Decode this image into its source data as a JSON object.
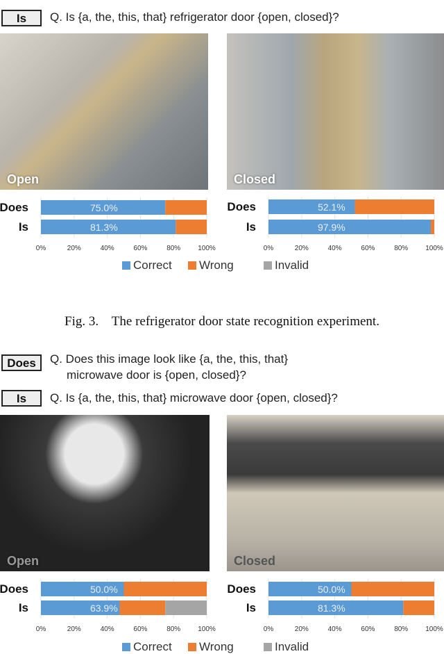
{
  "section1": {
    "is_tag": "Is",
    "is_question": "Q. Is {a, the, this, that} refrigerator door {open, closed}?",
    "images": [
      {
        "label": "Open"
      },
      {
        "label": "Closed"
      }
    ],
    "caption": "Fig. 3.    The refrigerator door state recognition experiment."
  },
  "section2": {
    "does_tag": "Does",
    "does_question_line1": "Q. Does this image look like {a, the, this, that}",
    "does_question_line2": "microwave door is {open, closed}?",
    "is_tag": "Is",
    "is_question": "Q. Is {a, the, this, that} microwave door {open, closed}?",
    "images": [
      {
        "label": "Open"
      },
      {
        "label": "Closed"
      }
    ]
  },
  "colors": {
    "Correct": "#5b9bd5",
    "Wrong": "#ed7d31",
    "Invalid": "#a5a5a5"
  },
  "chart_data": [
    {
      "type": "bar",
      "orientation": "horizontal-stacked",
      "categories": [
        "Does",
        "Is"
      ],
      "series": [
        {
          "name": "Correct",
          "values": [
            75.0,
            81.3
          ]
        },
        {
          "name": "Wrong",
          "values": [
            25.0,
            18.7
          ]
        },
        {
          "name": "Invalid",
          "values": [
            0,
            0
          ]
        }
      ],
      "data_labels": [
        "75.0%",
        "81.3%"
      ],
      "xticks": [
        "0%",
        "20%",
        "40%",
        "60%",
        "80%",
        "100%"
      ],
      "xlim": [
        0,
        100
      ],
      "legend": "bottom"
    },
    {
      "type": "bar",
      "orientation": "horizontal-stacked",
      "categories": [
        "Does",
        "Is"
      ],
      "series": [
        {
          "name": "Correct",
          "values": [
            52.1,
            97.9
          ]
        },
        {
          "name": "Wrong",
          "values": [
            47.9,
            2.1
          ]
        },
        {
          "name": "Invalid",
          "values": [
            0,
            0
          ]
        }
      ],
      "data_labels": [
        "52.1%",
        "97.9%"
      ],
      "xticks": [
        "0%",
        "20%",
        "40%",
        "60%",
        "80%",
        "100%"
      ],
      "xlim": [
        0,
        100
      ],
      "legend": "bottom"
    },
    {
      "type": "bar",
      "orientation": "horizontal-stacked",
      "categories": [
        "Does",
        "Is"
      ],
      "series": [
        {
          "name": "Correct",
          "values": [
            50.0,
            47.5
          ]
        },
        {
          "name": "Wrong",
          "values": [
            50.0,
            27.5
          ]
        },
        {
          "name": "Invalid",
          "values": [
            0,
            25.0
          ]
        }
      ],
      "data_labels": [
        "50.0%",
        "63.9%"
      ],
      "xticks": [
        "0%",
        "20%",
        "40%",
        "60%",
        "80%",
        "100%"
      ],
      "xlim": [
        0,
        100
      ],
      "legend": "bottom"
    },
    {
      "type": "bar",
      "orientation": "horizontal-stacked",
      "categories": [
        "Does",
        "Is"
      ],
      "series": [
        {
          "name": "Correct",
          "values": [
            50.0,
            81.3
          ]
        },
        {
          "name": "Wrong",
          "values": [
            50.0,
            18.7
          ]
        },
        {
          "name": "Invalid",
          "values": [
            0,
            0
          ]
        }
      ],
      "data_labels": [
        "50.0%",
        "81.3%"
      ],
      "xticks": [
        "0%",
        "20%",
        "40%",
        "60%",
        "80%",
        "100%"
      ],
      "xlim": [
        0,
        100
      ],
      "legend": "bottom"
    }
  ],
  "legend": [
    "Correct",
    "Wrong",
    "Invalid"
  ]
}
